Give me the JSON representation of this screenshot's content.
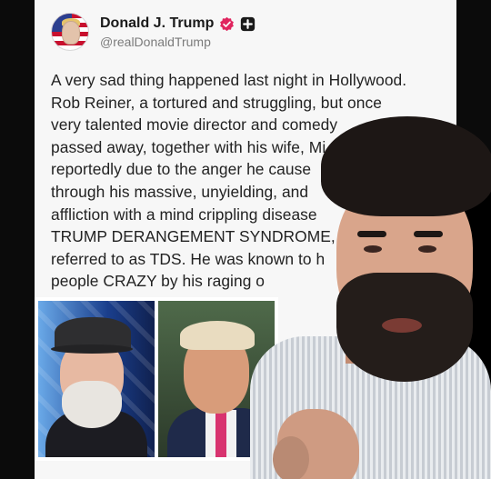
{
  "post": {
    "display_name": "Donald J. Trump",
    "handle": "@realDonaldTrump",
    "verified_color": "#e0245e",
    "lines": [
      "A very sad thing happened last night in Hollywood.",
      "Rob Reiner, a tortured and struggling, but once",
      "very talented movie director and comedy",
      "passed away, together with his wife, Mi",
      "reportedly due to the anger he cause",
      "through his massive, unyielding, and",
      "affliction with a mind crippling disease",
      "TRUMP DERANGEMENT SYNDROME, s",
      "referred to as TDS. He was known to h",
      "people CRAZY by his raging o"
    ]
  },
  "icons": {
    "verified": "verified-badge-icon",
    "plus": "plus-square-icon"
  }
}
